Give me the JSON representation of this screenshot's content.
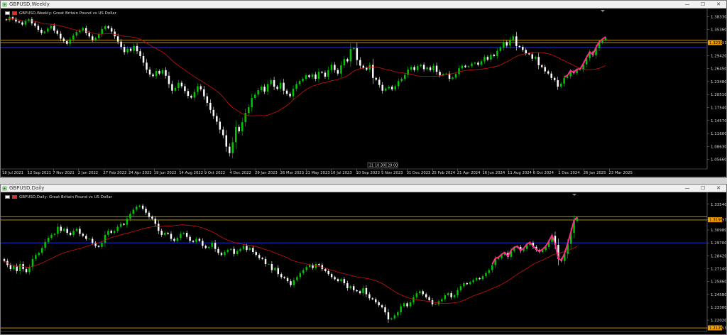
{
  "windows": {
    "weekly": {
      "title": "GBPUSD,Weekly",
      "legend": "GBPUSD,Weekly:  Great Britain Pound vs US Dollar",
      "price_labels": [
        "1.38330",
        "1.35360",
        "1.32391",
        "1.29420",
        "1.26450",
        "1.23480",
        "1.20510",
        "1.17540",
        "1.14570",
        "1.11600",
        "1.08630",
        "1.05660"
      ],
      "current_price": "1.32391",
      "date_labels": [
        "18 Jul 2021",
        "12 Sep 2021",
        "7 Nov 2021",
        "2 Jan 2022",
        "27 Feb 2022",
        "24 Apr 2022",
        "19 Jun 2022",
        "14 Aug 2022",
        "9 Oct 2022",
        "4 Dec 2022",
        "29 Jan 2023",
        "26 Mar 2023",
        "21 May 2023",
        "16 Jul 2023",
        "10 Sep 2023",
        "5 Nov 2023",
        "31 Dec 2023",
        "25 Feb 2024",
        "21 Apr 2024",
        "16 Jun 2024",
        "11 Aug 2024",
        "6 Oct 2024",
        "1 Dec 2024",
        "26 Jan 2025",
        "23 Mar 2025"
      ],
      "crosshair_labels": [
        "21 10:30",
        "29.00"
      ]
    },
    "daily": {
      "title": "GBPUSD,Daily",
      "legend": "GBPUSD,Daily:  Great Britain Pound vs US Dollar",
      "price_labels": [
        "1.33540",
        "1.31997",
        "1.30980",
        "1.29700",
        "1.28420",
        "1.27140",
        "1.25860",
        "1.24580",
        "1.23300",
        "1.22020",
        "1.21253"
      ],
      "current_price": "1.31997",
      "bottom_price": "1.21253"
    }
  },
  "window_buttons": {
    "minimize": "—",
    "maximize": "☐",
    "close": "✕"
  },
  "colors": {
    "bull": "#00c800",
    "bear": "#ffffff",
    "ma": "#d01010",
    "pattern": "#ff2a8a",
    "hline_gold": "#c8a000",
    "hline_blue": "#1a2cff",
    "price_tag": "#f0a000"
  },
  "chart_data": [
    {
      "type": "candlestick",
      "title": "GBPUSD,Weekly",
      "ylim": [
        1.035,
        1.392
      ],
      "close_path": [
        1.375,
        1.382,
        1.378,
        1.372,
        1.37,
        1.365,
        1.373,
        1.377,
        1.368,
        1.362,
        1.353,
        1.346,
        1.349,
        1.356,
        1.362,
        1.351,
        1.344,
        1.333,
        1.327,
        1.321,
        1.331,
        1.34,
        1.348,
        1.352,
        1.357,
        1.346,
        1.338,
        1.33,
        1.334,
        1.343,
        1.355,
        1.361,
        1.357,
        1.349,
        1.338,
        1.326,
        1.314,
        1.302,
        1.31,
        1.305,
        1.316,
        1.304,
        1.293,
        1.278,
        1.262,
        1.251,
        1.247,
        1.259,
        1.253,
        1.261,
        1.248,
        1.229,
        1.214,
        1.22,
        1.232,
        1.224,
        1.213,
        1.202,
        1.198,
        1.211,
        1.224,
        1.217,
        1.201,
        1.186,
        1.17,
        1.156,
        1.143,
        1.125,
        1.112,
        1.086,
        1.071,
        1.096,
        1.131,
        1.121,
        1.142,
        1.163,
        1.176,
        1.197,
        1.205,
        1.215,
        1.223,
        1.212,
        1.229,
        1.238,
        1.223,
        1.218,
        1.232,
        1.214,
        1.207,
        1.201,
        1.218,
        1.229,
        1.236,
        1.241,
        1.249,
        1.245,
        1.251,
        1.241,
        1.257,
        1.255,
        1.246,
        1.261,
        1.273,
        1.261,
        1.253,
        1.272,
        1.286,
        1.281,
        1.309,
        1.311,
        1.284,
        1.271,
        1.266,
        1.262,
        1.273,
        1.243,
        1.239,
        1.227,
        1.214,
        1.219,
        1.223,
        1.217,
        1.224,
        1.236,
        1.241,
        1.25,
        1.262,
        1.268,
        1.261,
        1.27,
        1.273,
        1.263,
        1.267,
        1.261,
        1.271,
        1.257,
        1.249,
        1.252,
        1.253,
        1.241,
        1.244,
        1.252,
        1.265,
        1.271,
        1.268,
        1.27,
        1.276,
        1.278,
        1.273,
        1.281,
        1.291,
        1.285,
        1.296,
        1.293,
        1.305,
        1.312,
        1.325,
        1.317,
        1.33,
        1.338,
        1.316,
        1.314,
        1.307,
        1.299,
        1.297,
        1.287,
        1.291,
        1.272,
        1.268,
        1.258,
        1.253,
        1.243,
        1.238,
        1.223,
        1.23,
        1.243,
        1.247,
        1.258,
        1.254,
        1.261,
        1.262,
        1.274,
        1.288,
        1.301,
        1.295,
        1.311,
        1.324,
        1.33,
        1.335
      ]
    },
    {
      "type": "candlestick",
      "title": "GBPUSD,Daily",
      "ylim": [
        1.209,
        1.343
      ],
      "close_path": [
        1.279,
        1.275,
        1.271,
        1.274,
        1.269,
        1.276,
        1.271,
        1.268,
        1.273,
        1.281,
        1.285,
        1.287,
        1.292,
        1.298,
        1.302,
        1.305,
        1.306,
        1.313,
        1.309,
        1.311,
        1.307,
        1.305,
        1.309,
        1.311,
        1.306,
        1.304,
        1.301,
        1.301,
        1.297,
        1.294,
        1.293,
        1.297,
        1.305,
        1.309,
        1.307,
        1.309,
        1.313,
        1.316,
        1.315,
        1.321,
        1.326,
        1.33,
        1.333,
        1.334,
        1.331,
        1.327,
        1.323,
        1.321,
        1.316,
        1.309,
        1.305,
        1.307,
        1.306,
        1.301,
        1.299,
        1.302,
        1.306,
        1.307,
        1.303,
        1.299,
        1.298,
        1.301,
        1.299,
        1.294,
        1.292,
        1.293,
        1.297,
        1.291,
        1.287,
        1.285,
        1.288,
        1.29,
        1.291,
        1.286,
        1.289,
        1.291,
        1.294,
        1.29,
        1.292,
        1.288,
        1.285,
        1.282,
        1.281,
        1.276,
        1.276,
        1.27,
        1.272,
        1.266,
        1.263,
        1.262,
        1.259,
        1.255,
        1.26,
        1.263,
        1.267,
        1.27,
        1.273,
        1.275,
        1.272,
        1.276,
        1.275,
        1.271,
        1.269,
        1.266,
        1.263,
        1.261,
        1.259,
        1.261,
        1.257,
        1.252,
        1.254,
        1.25,
        1.249,
        1.247,
        1.252,
        1.246,
        1.242,
        1.241,
        1.238,
        1.235,
        1.233,
        1.228,
        1.221,
        1.222,
        1.225,
        1.228,
        1.234,
        1.237,
        1.234,
        1.238,
        1.243,
        1.247,
        1.249,
        1.246,
        1.243,
        1.24,
        1.236,
        1.236,
        1.239,
        1.241,
        1.245,
        1.247,
        1.243,
        1.245,
        1.25,
        1.254,
        1.257,
        1.256,
        1.258,
        1.26,
        1.262,
        1.261,
        1.264,
        1.267,
        1.27,
        1.275,
        1.281,
        1.282,
        1.285,
        1.287,
        1.283,
        1.289,
        1.292,
        1.293,
        1.289,
        1.291,
        1.295,
        1.297,
        1.293,
        1.29,
        1.288,
        1.29,
        1.293,
        1.298,
        1.304,
        1.295,
        1.281,
        1.279,
        1.286,
        1.296,
        1.307,
        1.319,
        1.322
      ]
    }
  ]
}
